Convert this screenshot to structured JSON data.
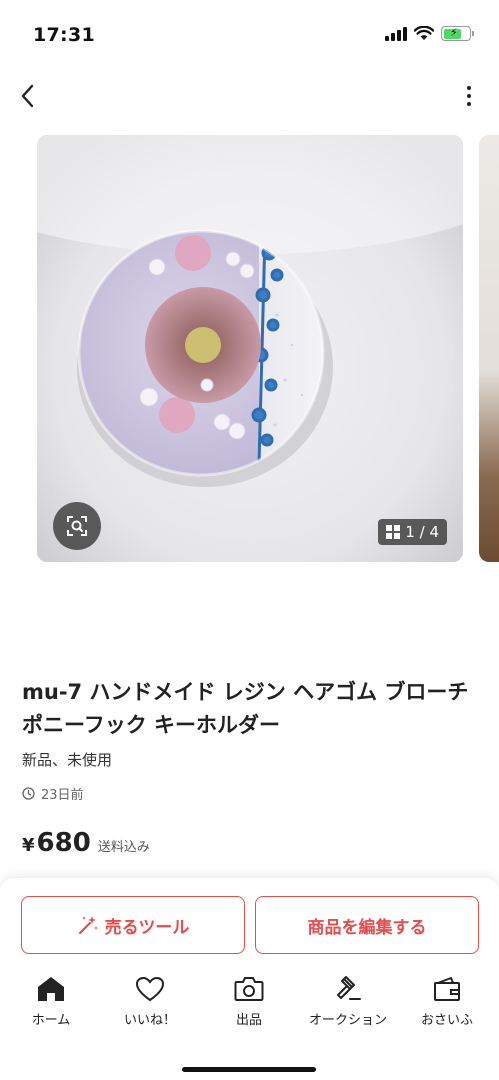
{
  "status_bar": {
    "time": "17:31"
  },
  "gallery": {
    "counter": "1 / 4"
  },
  "product": {
    "title": "mu-7 ハンドメイド レジン ヘアゴム ブローチ ポニーフック キーホルダー",
    "condition": "新品、未使用",
    "posted": "23日前",
    "currency": "¥",
    "price": "680",
    "price_note": "送料込み"
  },
  "actions": {
    "sell_tool_label": "売るツール",
    "edit_label": "商品を編集する"
  },
  "tabs": [
    {
      "label": "ホーム",
      "icon": "home-icon"
    },
    {
      "label": "いいね！",
      "icon": "heart-icon"
    },
    {
      "label": "出品",
      "icon": "camera-icon"
    },
    {
      "label": "オークション",
      "icon": "gavel-icon"
    },
    {
      "label": "おさいふ",
      "icon": "wallet-icon"
    }
  ],
  "colors": {
    "accent": "#e54d4d",
    "battery": "#4cd964"
  }
}
